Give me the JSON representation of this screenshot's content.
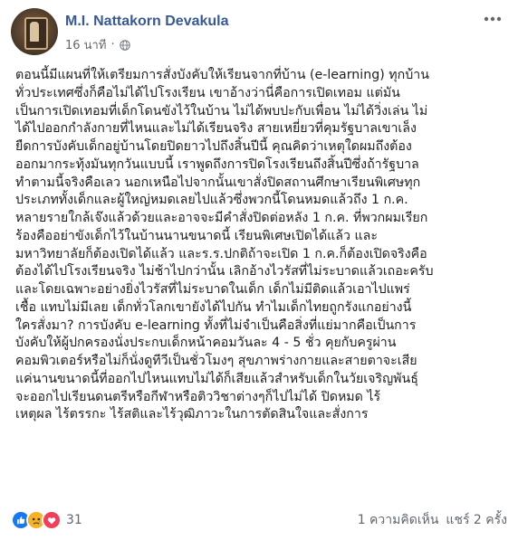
{
  "post": {
    "author": "M.I. Nattakorn Devakula",
    "timestamp": "16 นาที",
    "privacy_icon": "globe-icon",
    "more_icon": "more-dots-icon",
    "body_lines": [
      "ตอนนี้มีแผนที่ให้เตรียมการสั่งบังคับให้เรียนจากที่บ้าน (e-learning) ทุกบ้าน",
      "ทั่วประเทศซึ่งก็คือไม่ได้ไปโรงเรียน เขาอ้างว่านี่คือการเปิดเทอม แต่มัน",
      "เป็นการเปิดเทอมที่เด็กโดนขังไว้ในบ้าน ไม่ได้พบปะกับเพื่อน ไม่ได้วิ่งเล่น ไม่",
      "ได้ไปออกกำลังกายที่ไหนและไม่ได้เรียนจริง สายเหยี่ยวที่คุมรัฐบาลเขาเล็ง",
      "ยืดการบังคับเด็กอยู่บ้านโดยปิดยาวไปถึงสิ้นปีนี้ คุณคิดว่าเหตุใดผมถึงต้อง",
      "ออกมากระทุ้งมันทุกวันแบบนี้ เราพูดถึงการปิดโรงเรียนถึงสิ้นปีซึ่งถ้ารัฐบาล",
      "ทำตามนี้จริงคือเลว นอกเหนือไปจากนั้นเขาสั่งปิดสถานศึกษาเรียนพิเศษทุก",
      "ประเภททั้งเด็กและผู้ใหญ่หมดเลยไปแล้วซึ่งพวกนี้โดนหมดแล้วถึง 1 ก.ค.",
      "หลายรายใกล้เจ๊งแล้วด้วยและอาจจะมีคำสั่งปิดต่อหลัง 1 ก.ค. ที่พวกผมเรียก",
      "ร้องคืออย่าขังเด็กไว้ในบ้านนานขนาดนี้ เรียนพิเศษเปิดได้แล้ว และ",
      "มหาวิทยาลัยก็ต้องเปิดได้แล้ว และร.ร.ปกติถ้าจะเปิด 1 ก.ค.ก็ต้องเปิดจริงคือ",
      "ต้องได้ไปโรงเรียนจริง ไม่ช้าไปกว่านั้น เลิกอ้างไวรัสที่ไม่ระบาดแล้วเถอะครับ",
      "และโดยเฉพาะอย่างยิ่งไวรัสที่ไม่ระบาดในเด็ก เด็กไม่มีติดแล้วเอาไปแพร่",
      "เชื้อ แทบไม่มีเลย เด็กทั่วโลกเขายังได้ไปกัน ทำไมเด็กไทยถูกรังแกอย่างนี้",
      "ใครสั่งมา? การบังคับ e-learning ทั้งที่ไม่จำเป็นคือสิ่งที่แย่มากคือเป็นการ",
      "บังคับให้ผู้ปกครองนั่งประกบเด็กหน้าคอมวันละ 4 - 5 ชั่ว คุยกับครูผ่าน",
      "คอมพิวเตอร์หรือไม่ก็นั่งดูทีวีเป็นชั่วโมงๆ สุขภาพร่างกายและสายตาจะเสีย",
      "แค่นานขนาดนี้ที่ออกไปไหนแทบไม่ได้ก็เสียแล้วสำหรับเด็กในวัยเจริญพันธุ์",
      "จะออกไปเรียนดนตรีหรือกีฬาหรือติววิชาต่างๆก็ไปไม่ได้ ปิดหมด ไร้",
      "เหตุผล ไร้ตรรกะ ไร้สติและไร้วุฒิภาวะในการตัดสินใจและสั่งการ"
    ]
  },
  "footer": {
    "reactions": [
      {
        "name": "like-icon",
        "color": "#1877f2"
      },
      {
        "name": "sad-icon",
        "color": "#f7b125"
      },
      {
        "name": "love-icon",
        "color": "#f33e58"
      }
    ],
    "reaction_count": "31",
    "comments_label": "1 ความคิดเห็น",
    "shares_label": "แชร์ 2 ครั้ง"
  }
}
